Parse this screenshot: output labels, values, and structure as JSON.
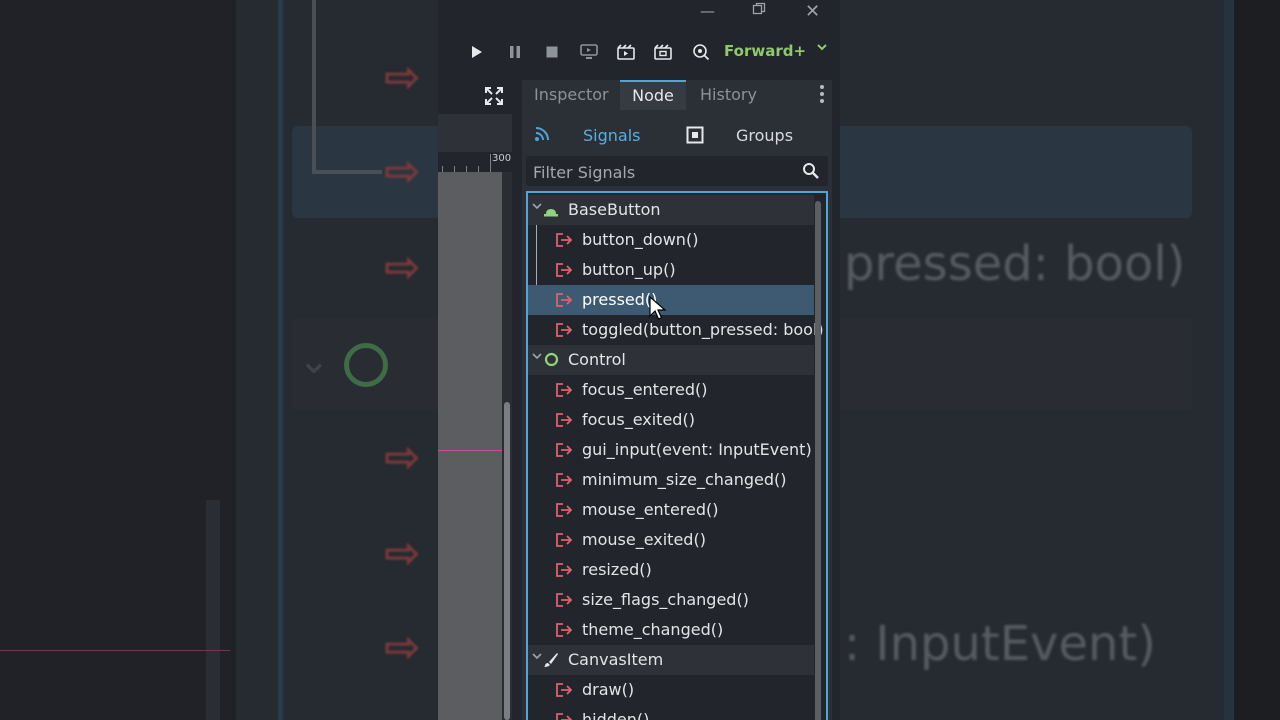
{
  "background": {
    "echo_signal_text": "pressed: bool)",
    "echo_signal_text_2": ": InputEvent)"
  },
  "toolbar": {
    "renderer_label": "Forward+"
  },
  "viewport": {
    "ruler_label": "300"
  },
  "dock": {
    "tabs": [
      {
        "label": "Inspector"
      },
      {
        "label": "Node"
      },
      {
        "label": "History"
      }
    ],
    "active_tab": "Node",
    "subtabs": {
      "signals_label": "Signals",
      "groups_label": "Groups"
    },
    "filter": {
      "placeholder": "Filter Signals",
      "value": ""
    }
  },
  "signals": {
    "categories": [
      {
        "name": "BaseButton",
        "icon": "basebutton-icon",
        "items": [
          "button_down()",
          "button_up()",
          "pressed()",
          "toggled(button_pressed: bool)"
        ]
      },
      {
        "name": "Control",
        "icon": "control-circle-icon",
        "items": [
          "focus_entered()",
          "focus_exited()",
          "gui_input(event: InputEvent)",
          "minimum_size_changed()",
          "mouse_entered()",
          "mouse_exited()",
          "resized()",
          "size_flags_changed()",
          "theme_changed()"
        ]
      },
      {
        "name": "CanvasItem",
        "icon": "brush-icon",
        "items": [
          "draw()",
          "hidden()"
        ]
      }
    ],
    "selected": "pressed()"
  },
  "colors": {
    "accent": "#4fa5d8",
    "signal_arrow": "#e0606b",
    "renderer": "#8fc96a",
    "selection": "#3d5a72"
  }
}
